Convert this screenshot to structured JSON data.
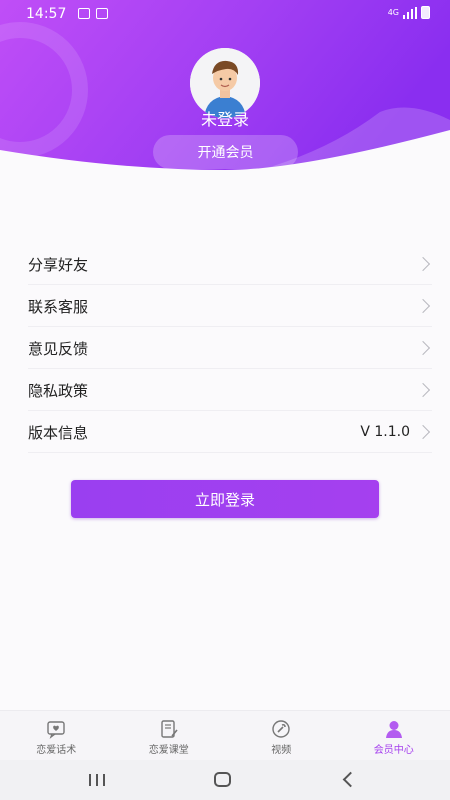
{
  "status_bar": {
    "time": "14:57",
    "network": "4G"
  },
  "profile": {
    "username": "未登录",
    "vip_button": "开通会员"
  },
  "menu": [
    {
      "label": "分享好友",
      "value": ""
    },
    {
      "label": "联系客服",
      "value": ""
    },
    {
      "label": "意见反馈",
      "value": ""
    },
    {
      "label": "隐私政策",
      "value": ""
    },
    {
      "label": "版本信息",
      "value": "V 1.1.0"
    }
  ],
  "login_button": "立即登录",
  "tabs": [
    {
      "label": "恋爱话术",
      "icon": "chat-heart-icon",
      "active": false
    },
    {
      "label": "恋爱课堂",
      "icon": "notebook-icon",
      "active": false
    },
    {
      "label": "视频",
      "icon": "wrench-icon",
      "active": false
    },
    {
      "label": "会员中心",
      "icon": "user-icon",
      "active": true
    }
  ],
  "colors": {
    "accent": "#a53fee",
    "header_start": "#b347f5",
    "header_end": "#8d2ef2"
  }
}
